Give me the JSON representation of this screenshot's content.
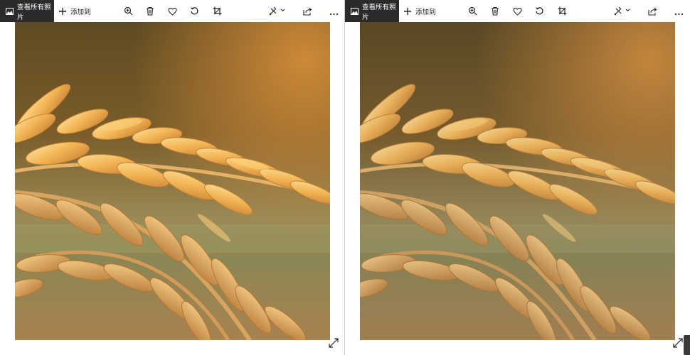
{
  "panes": [
    {
      "toolbar": {
        "view_all_label": "查看所有照片",
        "add_to_label": "添加到"
      }
    },
    {
      "toolbar": {
        "view_all_label": "查看所有照片",
        "add_to_label": "添加到"
      }
    }
  ],
  "icons": {
    "view_all": "photo-icon",
    "add": "plus-icon",
    "zoom": "zoom-in-icon",
    "delete": "trash-icon",
    "favorite": "heart-icon",
    "rotate": "rotate-icon",
    "crop": "crop-icon",
    "edit": "edit-enhance-icon",
    "share": "share-icon",
    "more": "more-icon",
    "expand": "expand-icon"
  },
  "colors": {
    "toolbar_bg": "#ffffff",
    "view_all_bg": "#2b2b2b",
    "photo_warm": "#e7a94a",
    "photo_bg": "#8a6a2e"
  }
}
